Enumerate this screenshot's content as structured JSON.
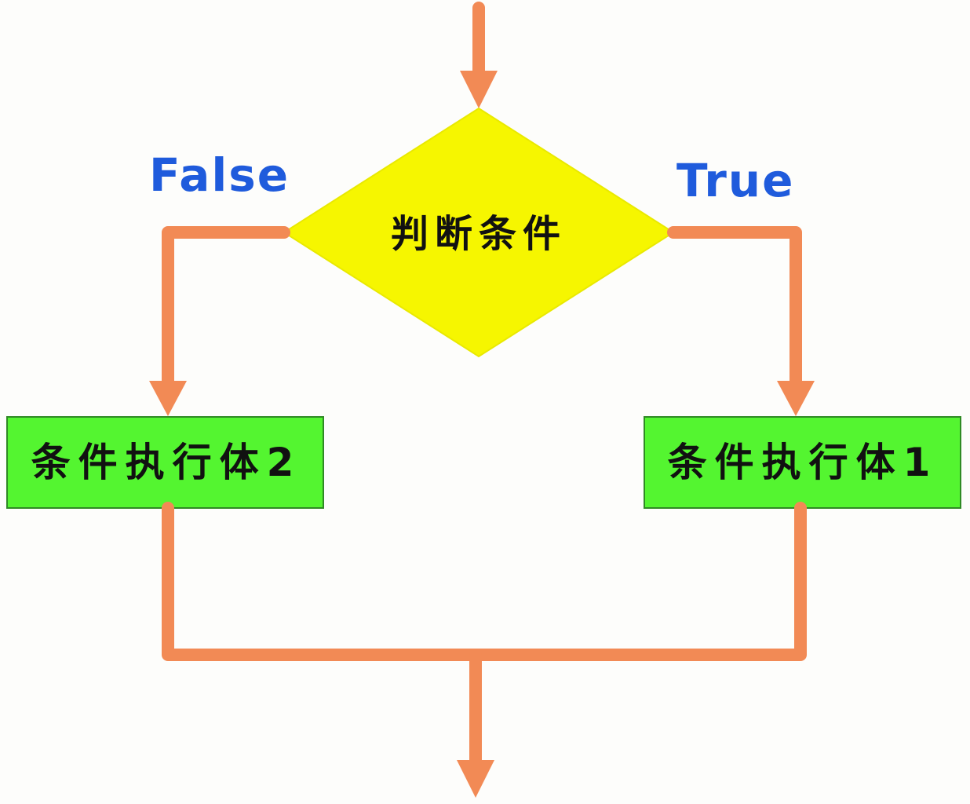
{
  "diagram": {
    "decision": {
      "label": "判断条件"
    },
    "branches": {
      "false_label": "False",
      "true_label": "True"
    },
    "nodes": {
      "left_box": "条件执行体2",
      "right_box": "条件执行体1"
    },
    "colors": {
      "arrow": "#f28a55",
      "decision_fill": "#f6f600",
      "box_fill": "#54f530",
      "box_border": "#2f8a24",
      "branch_text": "#1f5bdc",
      "text": "#111111",
      "background": "#fdfdfb"
    }
  }
}
